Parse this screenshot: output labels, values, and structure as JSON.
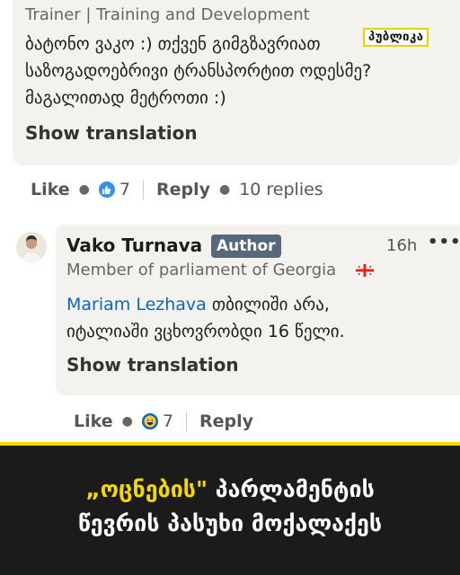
{
  "comment": {
    "subtitle": "Trainer | Training and Development",
    "text_line1": "ბატონო ვაკო :) თქვენ გიმგზავრიათ",
    "text_line2": "საზოგადოებრივი ტრანსპორტით ოდესმე?",
    "text_line3": "მაგალითად მეტროთი :)",
    "tag": "პუბლიკა",
    "show_translation": "Show translation",
    "actions": {
      "like_label": "Like",
      "reaction_icon": "like-icon",
      "reaction_count": "7",
      "reply_label": "Reply",
      "replies": "10 replies"
    }
  },
  "reply": {
    "name": "Vako Turnava",
    "badge": "Author",
    "time": "16h",
    "more_icon": "more-icon",
    "headline": "Member of parliament of Georgia",
    "flag_icon": "georgia-flag-icon",
    "mention": "Mariam Lezhava",
    "text_after_mention": "თბილიში არა,",
    "text_line2": "იტალიაში ვცხოვრობდი 16 წელი.",
    "show_translation": "Show translation",
    "actions": {
      "like_label": "Like",
      "reaction_icon": "laugh-icon",
      "reaction_count": "7",
      "reply_label": "Reply"
    }
  },
  "banner": {
    "quote_part": "„ოცნების\"",
    "line1_rest": "პარლამენტის",
    "line2": "წევრის პასუხი მოქალაქეს"
  },
  "colors": {
    "accent_yellow": "#f5d800",
    "link_blue": "#0a66c2",
    "badge_gray": "#56687a",
    "card_bg": "#f3f2ef",
    "banner_bg": "#1b1b1b"
  }
}
